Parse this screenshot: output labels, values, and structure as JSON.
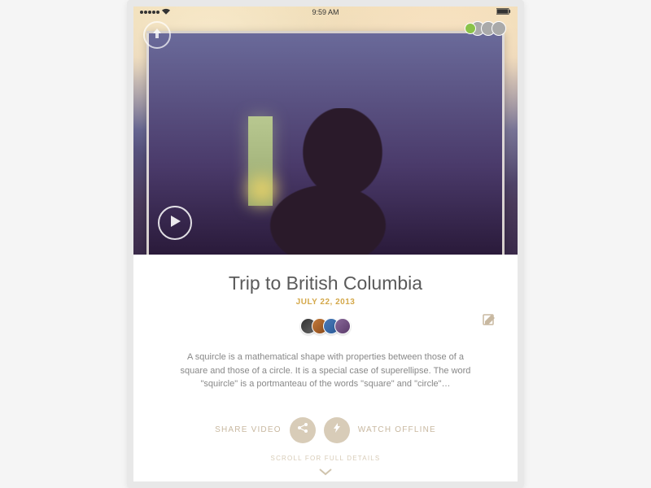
{
  "status": {
    "time": "9:59 AM",
    "battery_pct": 100
  },
  "post": {
    "title": "Trip to British Columbia",
    "date": "JULY 22, 2013",
    "description": "A squircle is a mathematical shape with properties between those of a square and those of a circle. It is a special case of superellipse. The word \"squircle\" is a portmanteau of the words \"square\" and \"circle\"…"
  },
  "actions": {
    "share_label": "SHARE VIDEO",
    "offline_label": "WATCH OFFLINE"
  },
  "hints": {
    "scroll": "SCROLL FOR FULL DETAILS"
  },
  "avatars": {
    "count": 4
  }
}
